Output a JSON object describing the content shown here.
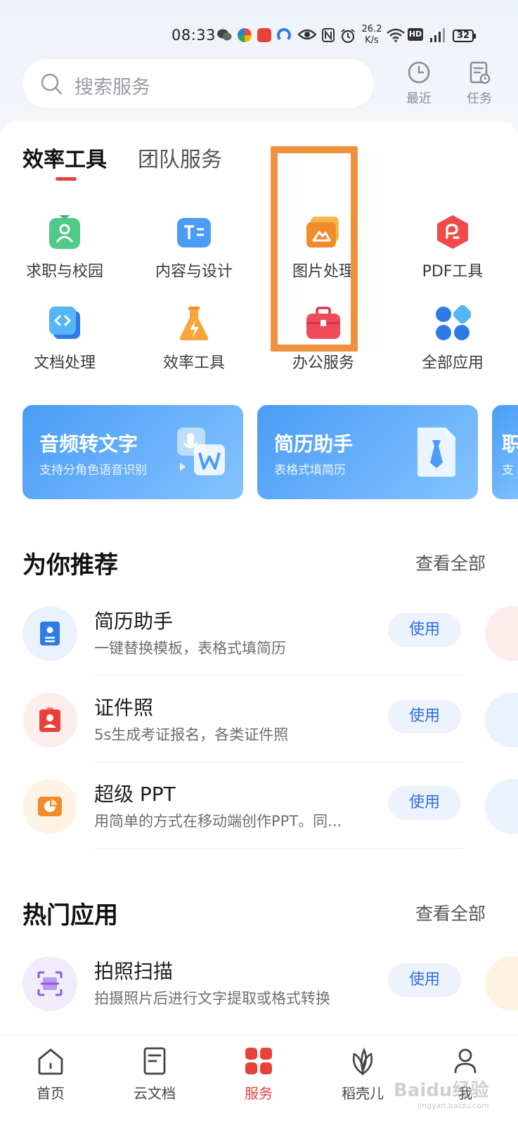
{
  "status_bar": {
    "time": "08:33",
    "net_speed_value": "26.2",
    "net_speed_unit": "K/s",
    "hd_label": "HD",
    "battery": "32"
  },
  "header": {
    "search_placeholder": "搜索服务",
    "recent_label": "最近",
    "tasks_label": "任务"
  },
  "tabs": [
    {
      "label": "效率工具",
      "active": true
    },
    {
      "label": "团队服务",
      "active": false
    }
  ],
  "tools": [
    {
      "label": "求职与校园",
      "icon": "campus-icon"
    },
    {
      "label": "内容与设计",
      "icon": "text-design-icon"
    },
    {
      "label": "图片处理",
      "icon": "image-icon"
    },
    {
      "label": "PDF工具",
      "icon": "pdf-icon"
    },
    {
      "label": "文档处理",
      "icon": "document-code-icon"
    },
    {
      "label": "效率工具",
      "icon": "flask-lightning-icon"
    },
    {
      "label": "办公服务",
      "icon": "briefcase-icon"
    },
    {
      "label": "全部应用",
      "icon": "grid-apps-icon"
    }
  ],
  "banners": [
    {
      "title": "音频转文字",
      "subtitle": "支持分角色语音识别"
    },
    {
      "title": "简历助手",
      "subtitle": "表格式填简历"
    },
    {
      "title": "职",
      "subtitle": "支"
    }
  ],
  "recommend": {
    "title": "为你推荐",
    "see_all": "查看全部",
    "items": [
      {
        "title": "简历助手",
        "desc": "一键替换模板，表格式填简历",
        "action": "使用",
        "icon": "resume-icon"
      },
      {
        "title": "证件照",
        "desc": "5s生成考证报名，各类证件照",
        "action": "使用",
        "icon": "id-photo-icon"
      },
      {
        "title": "超级 PPT",
        "desc": "用简单的方式在移动端创作PPT。同...",
        "action": "使用",
        "icon": "ppt-icon"
      }
    ]
  },
  "hot_apps": {
    "title": "热门应用",
    "see_all": "查看全部",
    "items": [
      {
        "title": "拍照扫描",
        "desc": "拍摄照片后进行文字提取或格式转换",
        "action": "使用",
        "icon": "scan-icon"
      }
    ]
  },
  "bottom_nav": [
    {
      "label": "首页",
      "icon": "home-icon",
      "active": false
    },
    {
      "label": "云文档",
      "icon": "cloud-doc-icon",
      "active": false
    },
    {
      "label": "服务",
      "icon": "services-icon",
      "active": true
    },
    {
      "label": "稻壳儿",
      "icon": "leaf-icon",
      "active": false
    },
    {
      "label": "我",
      "icon": "profile-icon",
      "active": false
    }
  ],
  "watermark": {
    "text": "Baidu经验",
    "sub": "jingyan.baidu.com"
  },
  "colors": {
    "accent_red": "#e8413a",
    "highlight_orange": "#f0913f",
    "banner_blue": "#4a9cf5",
    "use_button_text": "#2f6fe0"
  }
}
